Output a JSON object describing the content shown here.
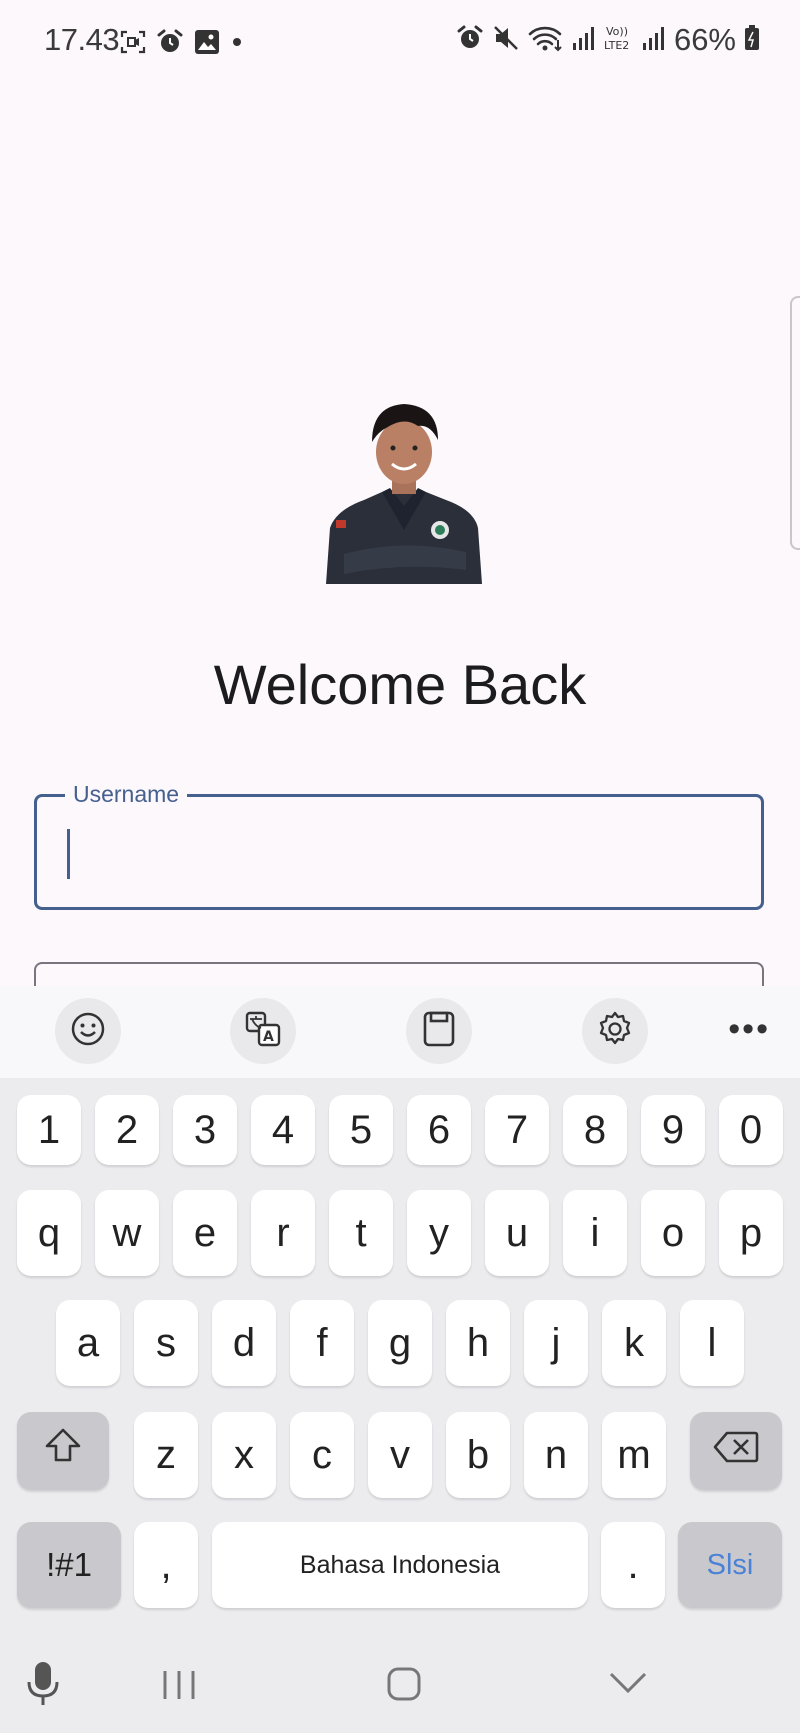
{
  "status_bar": {
    "time": "17.43",
    "battery": "66%",
    "network_label": "Vo)) LTE2"
  },
  "login": {
    "title": "Welcome Back",
    "username": {
      "label": "Username",
      "value": ""
    }
  },
  "keyboard": {
    "number_row": [
      "1",
      "2",
      "3",
      "4",
      "5",
      "6",
      "7",
      "8",
      "9",
      "0"
    ],
    "row1": [
      "q",
      "w",
      "e",
      "r",
      "t",
      "y",
      "u",
      "i",
      "o",
      "p"
    ],
    "row2": [
      "a",
      "s",
      "d",
      "f",
      "g",
      "h",
      "j",
      "k",
      "l"
    ],
    "row3": [
      "z",
      "x",
      "c",
      "v",
      "b",
      "n",
      "m"
    ],
    "symbols_key": "!#1",
    "comma_key": ",",
    "space_label": "Bahasa Indonesia",
    "period_key": ".",
    "enter_label": "Slsi"
  },
  "colors": {
    "accent": "#45608f",
    "enter_text": "#4b82d6",
    "background": "#fcf8fb"
  }
}
